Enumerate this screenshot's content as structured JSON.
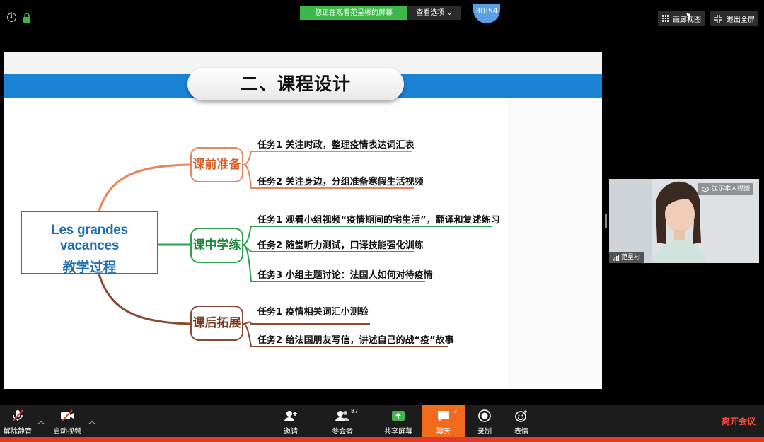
{
  "topbar": {
    "share_banner": "您正在观看范呈彬的屏幕",
    "view_options": "查看选项",
    "timer": "30:54",
    "gallery_view": "画廊视图",
    "exit_fullscreen": "退出全屏"
  },
  "slide": {
    "title": "二、课程设计",
    "root_line1": "Les grandes vacances",
    "root_line2": "教学过程",
    "branches": [
      {
        "label": "课前准备",
        "tasks": [
          "任务1 关注时政，整理疫情表达词汇表",
          "任务2 关注身边，分组准备寒假生活视频"
        ]
      },
      {
        "label": "课中学练",
        "tasks": [
          "任务1 观看小组视频“疫情期间的宅生活”，翻译和复述练习",
          "任务2 随堂听力测试，口译技能强化训练",
          "任务3 小组主题讨论：法国人如何对待疫情"
        ]
      },
      {
        "label": "课后拓展",
        "tasks": [
          "任务1 疫情相关词汇小测验",
          "任务2 给法国朋友写信，讲述自己的战“疫”故事"
        ]
      }
    ],
    "colors": {
      "pre": "#e8855a",
      "mid": "#2fa04f",
      "post": "#8a4a32",
      "root": "#1f78b4",
      "band": "#1a83d4"
    }
  },
  "webcam": {
    "self_view_button": "显示本人视图",
    "participant_name": "范呈彬"
  },
  "toolbar": {
    "unmute": "解除静音",
    "start_video": "启动视频",
    "invite": "邀请",
    "participants": "参会者",
    "participants_count": "87",
    "share_screen": "共享屏幕",
    "chat": "聊天",
    "chat_badge": "3",
    "record": "录制",
    "reactions": "表情",
    "leave": "离开会议"
  },
  "icons": [
    "info-icon",
    "lock-icon",
    "grid-icon",
    "exit-fullscreen-icon",
    "eye-icon",
    "signal-icon",
    "mic-muted-icon",
    "video-off-icon",
    "invite-icon",
    "participants-icon",
    "share-screen-icon",
    "chat-icon",
    "record-icon",
    "reaction-icon"
  ]
}
